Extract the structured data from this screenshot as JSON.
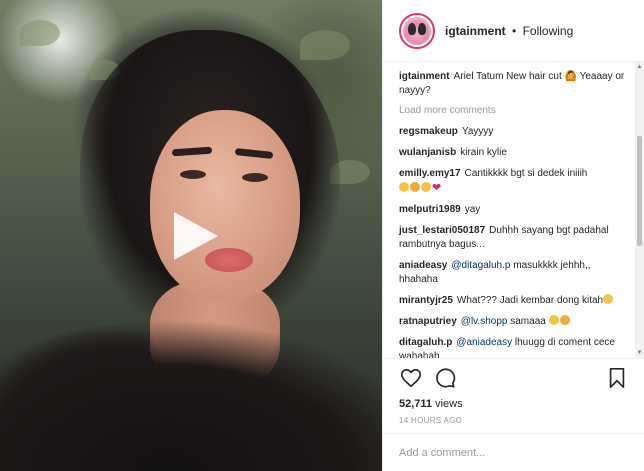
{
  "header": {
    "username": "igtainment",
    "separator": "•",
    "follow_status": "Following"
  },
  "caption": {
    "username": "igtainment",
    "text": "Ariel Tatum New hair cut 🙆 Yeaaay or nayyy?"
  },
  "load_more": "Load more comments",
  "comments": [
    {
      "username": "regsmakeup",
      "text": "Yayyyy"
    },
    {
      "username": "wulanjanisb",
      "text": "kirain kylie"
    },
    {
      "username": "emilly.emy17",
      "text": "Cantikkkk bgt si dedek iniiih"
    },
    {
      "username": "melputri1989",
      "text": "yay"
    },
    {
      "username": "just_lestari050187",
      "text": "Duhhh sayang bgt padahal rambutnya bagus..."
    },
    {
      "username": "aniadeasy",
      "mention": "@ditagaluh.p",
      "text": "masukkkk jehhh,, hhahaha"
    },
    {
      "username": "mirantyjr25",
      "text": "What??? Jadi kembar dong kitah"
    },
    {
      "username": "ratnaputriey",
      "mention": "@lv.shopp",
      "text": "samaaa"
    },
    {
      "username": "ditagaluh.p",
      "mention": "@aniadeasy",
      "text": "lhuugg di coment cece wahahah"
    }
  ],
  "actions": {
    "views_count": "52,711",
    "views_label": "views",
    "timestamp": "14 HOURS AGO"
  },
  "add_comment": {
    "placeholder": "Add a comment..."
  },
  "icons": {
    "like": "heart-icon",
    "comment": "comment-bubble-icon",
    "save": "bookmark-icon",
    "play": "play-icon"
  },
  "colors": {
    "mention": "#003569",
    "muted": "#999999",
    "text": "#262626",
    "border": "#efefef"
  }
}
